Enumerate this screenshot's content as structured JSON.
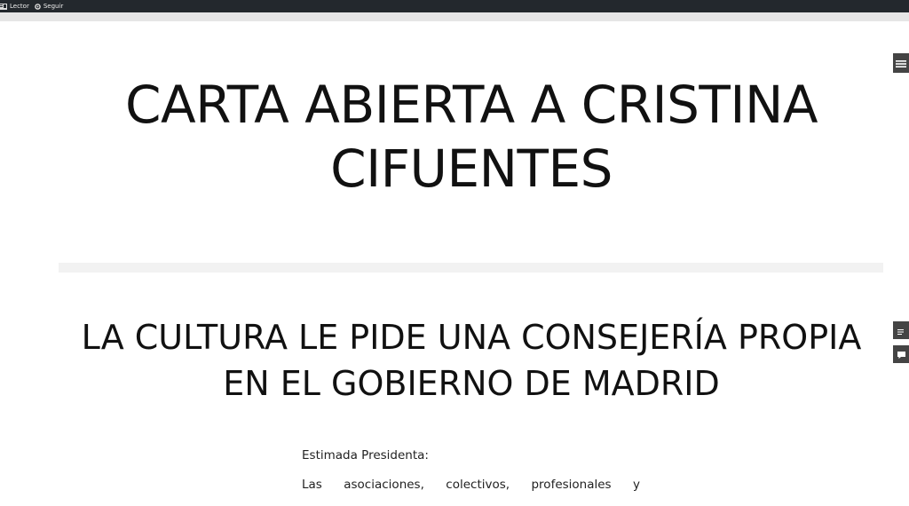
{
  "adminbar": {
    "reader_label": "Lector",
    "follow_label": "Seguir"
  },
  "site": {
    "title": "CARTA ABIERTA A CRISTINA CIFUENTES"
  },
  "post": {
    "title": "LA CULTURA LE PIDE UNA CONSEJERÍA PROPIA EN EL GOBIERNO DE MADRID",
    "greeting": "Estimada Presidenta:",
    "first_line": "Las asociaciones, colectivos, profesionales y"
  },
  "icons": {
    "reader": "reader-icon",
    "follow": "gear-icon",
    "menu": "hamburger-menu-icon",
    "list": "list-icon",
    "comment": "comment-icon"
  },
  "colors": {
    "adminbar": "#23282d",
    "text": "#111111",
    "side_button": "#444444"
  }
}
